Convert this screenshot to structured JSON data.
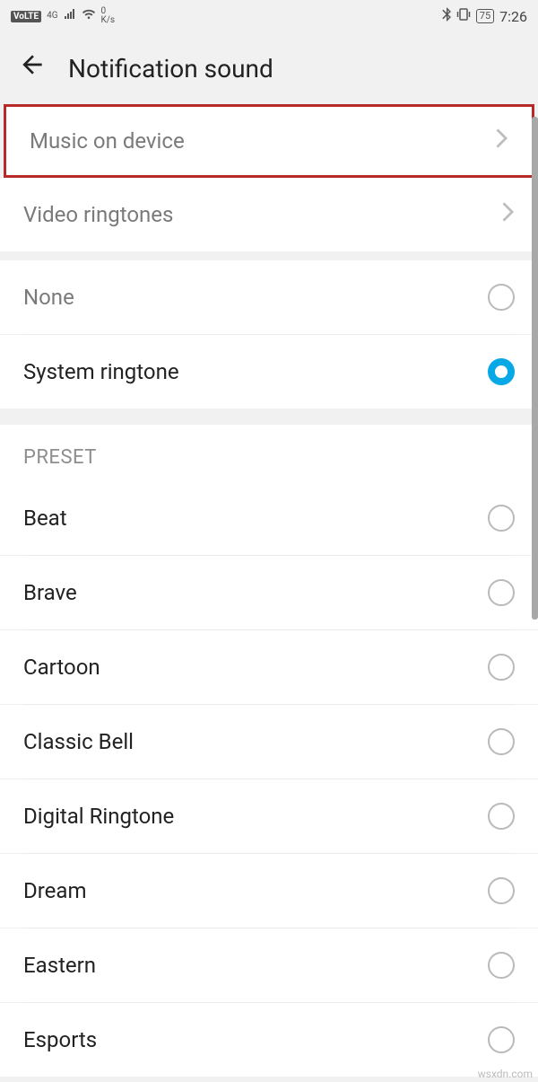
{
  "status": {
    "volte": "VoLTE",
    "net": "4G",
    "kbs_num": "0",
    "kbs_unit": "K/s",
    "battery": "75",
    "time": "7:26"
  },
  "header": {
    "title": "Notification sound"
  },
  "nav": {
    "music": "Music on device",
    "video": "Video ringtones"
  },
  "options": {
    "none": "None",
    "system": "System ringtone"
  },
  "preset_label": "PRESET",
  "presets": [
    "Beat",
    "Brave",
    "Cartoon",
    "Classic Bell",
    "Digital Ringtone",
    "Dream",
    "Eastern",
    "Esports"
  ],
  "watermark": "wsxdn.com"
}
